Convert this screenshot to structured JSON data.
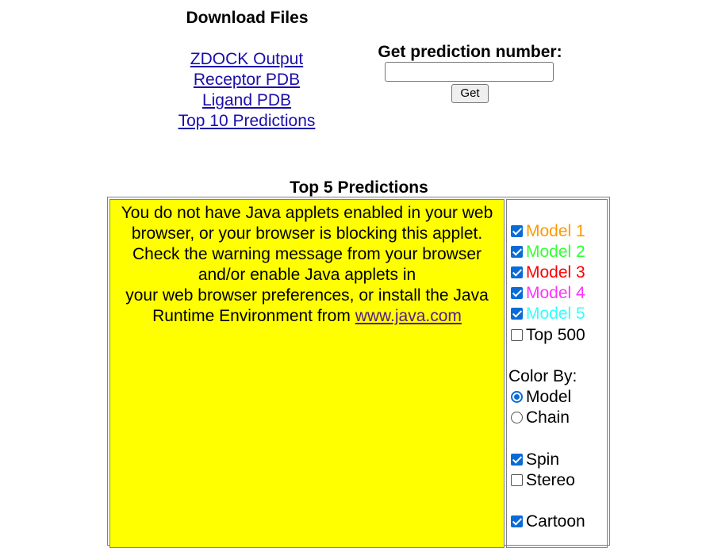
{
  "download": {
    "title": "Download Files",
    "links": [
      "ZDOCK Output",
      "Receptor PDB",
      "Ligand PDB",
      "Top 10 Predictions"
    ]
  },
  "prediction": {
    "title": "Get prediction number:",
    "input_value": "",
    "button_label": "Get"
  },
  "top5": {
    "title": "Top 5 Predictions",
    "applet_message_lines": [
      "You do not have Java applets enabled in your web",
      "browser, or your browser is blocking this applet.",
      "Check the warning message from your browser",
      "and/or enable Java applets in",
      "your web browser preferences, or install the Java"
    ],
    "applet_message_last": "Runtime Environment from",
    "java_link": "www.java.com"
  },
  "controls": {
    "models": [
      {
        "label": "Model 1",
        "checked": true,
        "color": "#ff9900"
      },
      {
        "label": "Model 2",
        "checked": true,
        "color": "#33ff33"
      },
      {
        "label": "Model 3",
        "checked": true,
        "color": "#ff0000"
      },
      {
        "label": "Model 4",
        "checked": true,
        "color": "#ff33ff"
      },
      {
        "label": "Model 5",
        "checked": true,
        "color": "#33ffff"
      }
    ],
    "top500": {
      "label": "Top 500",
      "checked": false
    },
    "color_by_label": "Color By:",
    "color_by_options": [
      {
        "label": "Model",
        "selected": true
      },
      {
        "label": "Chain",
        "selected": false
      }
    ],
    "spin": {
      "label": "Spin",
      "checked": true
    },
    "stereo": {
      "label": "Stereo",
      "checked": false
    },
    "cartoon": {
      "label": "Cartoon",
      "checked": true
    }
  }
}
